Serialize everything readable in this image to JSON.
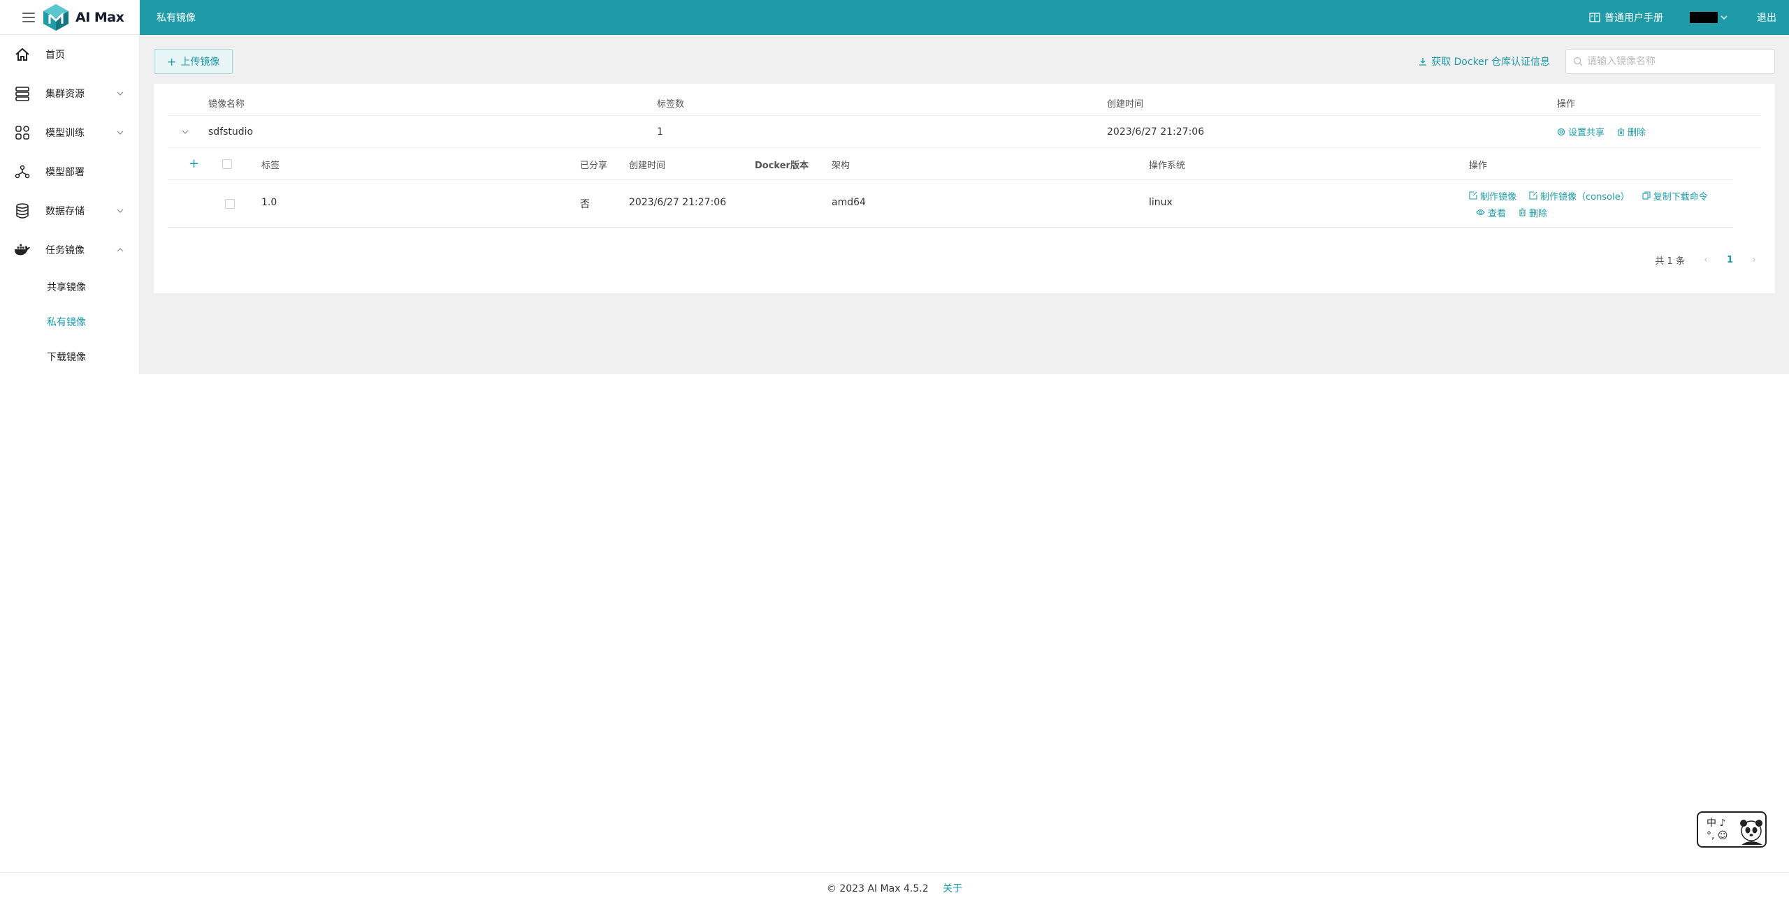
{
  "header": {
    "app_name": "AI Max",
    "breadcrumb": "私有镜像",
    "manual_label": "普通用户手册",
    "logout_label": "退出"
  },
  "sidebar": {
    "items": [
      {
        "label": "首页",
        "icon": "home-icon"
      },
      {
        "label": "集群资源",
        "icon": "server-icon"
      },
      {
        "label": "模型训练",
        "icon": "grid-icon"
      },
      {
        "label": "模型部署",
        "icon": "nodes-icon"
      },
      {
        "label": "数据存储",
        "icon": "database-icon"
      },
      {
        "label": "任务镜像",
        "icon": "docker-icon"
      }
    ],
    "subitems": [
      {
        "label": "共享镜像"
      },
      {
        "label": "私有镜像",
        "active": true
      },
      {
        "label": "下载镜像"
      }
    ]
  },
  "toolbar": {
    "upload_label": "上传镜像",
    "docker_link": "获取 Docker 仓库认证信息",
    "search_placeholder": "请输入镜像名称"
  },
  "table": {
    "columns": [
      "镜像名称",
      "标签数",
      "创建时间",
      "操作"
    ],
    "row": {
      "name": "sdfstudio",
      "tags": "1",
      "created": "2023/6/27 21:27:06",
      "op_share": "设置共享",
      "op_delete": "删除"
    },
    "inner_columns": [
      "标签",
      "已分享",
      "创建时间",
      "Docker版本",
      "架构",
      "操作系统",
      "操作"
    ],
    "inner_row": {
      "tag": "1.0",
      "shared": "否",
      "created": "2023/6/27 21:27:06",
      "arch": "amd64",
      "os": "linux",
      "op_make": "制作镜像",
      "op_make_console": "制作镜像（console）",
      "op_copy": "复制下载命令",
      "op_view": "查看",
      "op_delete": "删除"
    }
  },
  "pagination": {
    "total": "共 1 条",
    "current": "1"
  },
  "footer": {
    "copyright": "© 2023 AI Max 4.5.2",
    "about": "关于"
  },
  "ime": {
    "line1": "中 ♪",
    "line2": "°, ☺"
  },
  "colors": {
    "brand": "#1f9ba8",
    "content_bg": "#f0f0f0"
  }
}
